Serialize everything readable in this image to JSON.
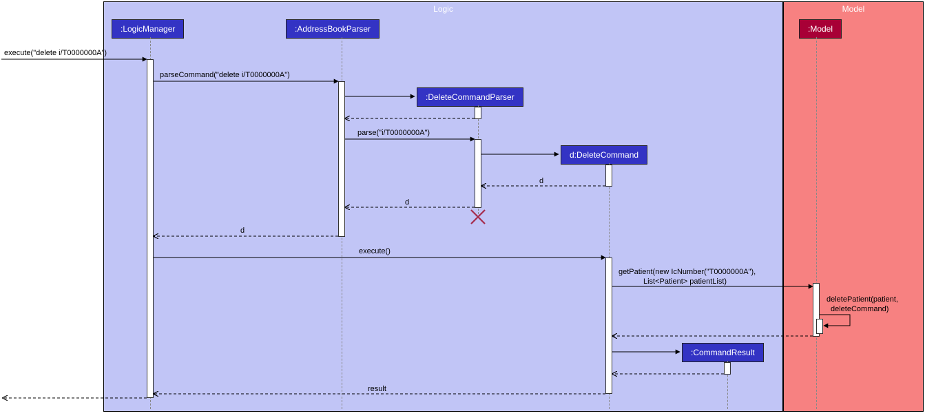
{
  "frames": {
    "logic": "Logic",
    "model": "Model"
  },
  "participants": {
    "logicManager": ":LogicManager",
    "addressBookParser": ":AddressBookParser",
    "deleteCommandParser": ":DeleteCommandParser",
    "deleteCommand": "d:DeleteCommand",
    "commandResult": ":CommandResult",
    "model": ":Model"
  },
  "messages": {
    "execute1": "execute(\"delete i/T0000000A\")",
    "parseCommand": "parseCommand(\"delete i/T0000000A\")",
    "parse": "parse(\"i/T0000000A\")",
    "d1": "d",
    "d2": "d",
    "d3": "d",
    "executeEmpty": "execute()",
    "getPatient1": "getPatient(new IcNumber(\"T0000000A\"),",
    "getPatient2": "List<Patient> patientList)",
    "deletePatient1": "deletePatient(patient,",
    "deletePatient2": "deleteCommand)",
    "result": "result"
  },
  "chart_data": {
    "type": "sequence-diagram",
    "frames": [
      {
        "name": "Logic",
        "participants": [
          "LogicManager",
          "AddressBookParser",
          "DeleteCommandParser",
          "DeleteCommand",
          "CommandResult"
        ]
      },
      {
        "name": "Model",
        "participants": [
          "Model"
        ]
      }
    ],
    "participants": [
      {
        "id": "LogicManager",
        "label": ":LogicManager"
      },
      {
        "id": "AddressBookParser",
        "label": ":AddressBookParser"
      },
      {
        "id": "DeleteCommandParser",
        "label": ":DeleteCommandParser"
      },
      {
        "id": "DeleteCommand",
        "label": "d:DeleteCommand"
      },
      {
        "id": "CommandResult",
        "label": ":CommandResult"
      },
      {
        "id": "Model",
        "label": ":Model"
      }
    ],
    "messages": [
      {
        "from": "external",
        "to": "LogicManager",
        "label": "execute(\"delete i/T0000000A\")",
        "type": "call"
      },
      {
        "from": "LogicManager",
        "to": "AddressBookParser",
        "label": "parseCommand(\"delete i/T0000000A\")",
        "type": "call"
      },
      {
        "from": "AddressBookParser",
        "to": "DeleteCommandParser",
        "label": "",
        "type": "create"
      },
      {
        "from": "DeleteCommandParser",
        "to": "AddressBookParser",
        "label": "",
        "type": "return"
      },
      {
        "from": "AddressBookParser",
        "to": "DeleteCommandParser",
        "label": "parse(\"i/T0000000A\")",
        "type": "call"
      },
      {
        "from": "DeleteCommandParser",
        "to": "DeleteCommand",
        "label": "",
        "type": "create"
      },
      {
        "from": "DeleteCommand",
        "to": "DeleteCommandParser",
        "label": "d",
        "type": "return"
      },
      {
        "from": "DeleteCommandParser",
        "to": "AddressBookParser",
        "label": "d",
        "type": "return"
      },
      {
        "from": "DeleteCommandParser",
        "to": "DeleteCommandParser",
        "label": "",
        "type": "destroy"
      },
      {
        "from": "AddressBookParser",
        "to": "LogicManager",
        "label": "d",
        "type": "return"
      },
      {
        "from": "LogicManager",
        "to": "DeleteCommand",
        "label": "execute()",
        "type": "call"
      },
      {
        "from": "DeleteCommand",
        "to": "Model",
        "label": "getPatient(new IcNumber(\"T0000000A\"), List<Patient> patientList)",
        "type": "call"
      },
      {
        "from": "Model",
        "to": "Model",
        "label": "deletePatient(patient, deleteCommand)",
        "type": "self"
      },
      {
        "from": "Model",
        "to": "DeleteCommand",
        "label": "",
        "type": "return"
      },
      {
        "from": "DeleteCommand",
        "to": "CommandResult",
        "label": "",
        "type": "create"
      },
      {
        "from": "CommandResult",
        "to": "DeleteCommand",
        "label": "",
        "type": "return"
      },
      {
        "from": "DeleteCommand",
        "to": "LogicManager",
        "label": "result",
        "type": "return"
      },
      {
        "from": "LogicManager",
        "to": "external",
        "label": "",
        "type": "return"
      }
    ]
  }
}
